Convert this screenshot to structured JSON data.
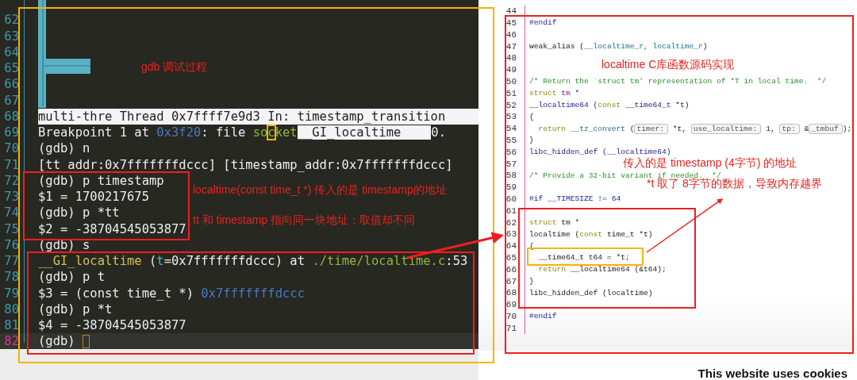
{
  "terminal": {
    "lines": [
      {
        "number": "62",
        "current": false
      },
      {
        "number": "63",
        "current": false
      },
      {
        "number": "64",
        "current": false
      },
      {
        "number": "65",
        "current": false
      },
      {
        "number": "66",
        "current": false
      },
      {
        "number": "67",
        "current": false
      },
      {
        "number": "68",
        "current": false,
        "kind": "status",
        "segments": [
          {
            "text": "multi-thre Thread 0x7ffff7e9d3 In: timestamp_transition",
            "kind": "plain"
          }
        ]
      },
      {
        "number": "69",
        "current": false,
        "segments": [
          {
            "text": "Breakpoint 1 at ",
            "kind": "plain"
          },
          {
            "text": "0x3f20",
            "kind": "address"
          },
          {
            "text": ": file ",
            "kind": "plain"
          },
          {
            "text": "so",
            "kind": "path"
          },
          {
            "text": "c",
            "kind": "marked"
          },
          {
            "text": "ket",
            "kind": "path"
          },
          {
            "text": "__GI_localtime",
            "kind": "popup"
          },
          {
            "text": "0.",
            "kind": "plain"
          }
        ]
      },
      {
        "number": "70",
        "current": false,
        "segments": [
          {
            "text": "(gdb) n",
            "kind": "plain"
          }
        ]
      },
      {
        "number": "71",
        "current": false,
        "segments": [
          {
            "text": "[tt_addr:0x7fffffffdccc] [timestamp_addr:0x7fffffffdccc]",
            "kind": "plain"
          }
        ]
      },
      {
        "number": "72",
        "current": false,
        "segments": [
          {
            "text": "(gdb) p timestamp",
            "kind": "plain"
          }
        ]
      },
      {
        "number": "73",
        "current": false,
        "segments": [
          {
            "text": "$1 = 1700217675",
            "kind": "plain"
          }
        ]
      },
      {
        "number": "74",
        "current": false,
        "segments": [
          {
            "text": "(gdb) p *tt",
            "kind": "plain"
          }
        ]
      },
      {
        "number": "75",
        "current": false,
        "segments": [
          {
            "text": "$2 = -38704545053877",
            "kind": "plain"
          }
        ]
      },
      {
        "number": "76",
        "current": false,
        "segments": [
          {
            "text": "(gdb) s",
            "kind": "plain"
          }
        ]
      },
      {
        "number": "77",
        "current": false,
        "segments": [
          {
            "text": "__GI_localtime",
            "kind": "function"
          },
          {
            "text": " (",
            "kind": "plain"
          },
          {
            "text": "t",
            "kind": "variable"
          },
          {
            "text": "=0x7fffffffdccc) at ",
            "kind": "plain"
          },
          {
            "text": "./time/localtime.c",
            "kind": "path"
          },
          {
            "text": ":53",
            "kind": "plain"
          }
        ]
      },
      {
        "number": "78",
        "current": false,
        "segments": [
          {
            "text": "(gdb) p t",
            "kind": "plain"
          }
        ]
      },
      {
        "number": "79",
        "current": false,
        "segments": [
          {
            "text": "$3 = (const time_t *) ",
            "kind": "plain"
          },
          {
            "text": "0x7fffffffdccc",
            "kind": "address"
          }
        ]
      },
      {
        "number": "80",
        "current": false,
        "segments": [
          {
            "text": "(gdb) p *t",
            "kind": "plain"
          }
        ]
      },
      {
        "number": "81",
        "current": false,
        "segments": [
          {
            "text": "$4 = -38704545053877",
            "kind": "plain"
          }
        ]
      },
      {
        "number": "82",
        "current": true,
        "segments": [
          {
            "text": "(gdb) ",
            "kind": "plain"
          }
        ]
      }
    ]
  },
  "source": {
    "lines": [
      {
        "number": "44"
      },
      {
        "number": "45",
        "segments": [
          {
            "text": "#endif",
            "kind": "preprocessor"
          }
        ]
      },
      {
        "number": "46"
      },
      {
        "number": "47",
        "segments": [
          {
            "text": "weak_alias (",
            "kind": "plain"
          },
          {
            "text": "__localtime_r, localtime_r",
            "kind": "type"
          },
          {
            "text": ")",
            "kind": "plain"
          }
        ]
      },
      {
        "number": "48"
      },
      {
        "number": "49"
      },
      {
        "number": "50",
        "segments": [
          {
            "text": "/* Return the `struct tm' representation of *T in local time.  */",
            "kind": "comment"
          }
        ]
      },
      {
        "number": "51",
        "segments": [
          {
            "text": "struct ",
            "kind": "keyword"
          },
          {
            "text": "tm",
            "kind": "macro"
          },
          {
            "text": " *",
            "kind": "plain"
          }
        ]
      },
      {
        "number": "52",
        "segments": [
          {
            "text": "__localtime64 (",
            "kind": "preprocessor"
          },
          {
            "text": "const",
            "kind": "keyword"
          },
          {
            "text": " __time64_t ",
            "kind": "preprocessor"
          },
          {
            "text": "*t)",
            "kind": "plain"
          }
        ]
      },
      {
        "number": "53",
        "segments": [
          {
            "text": "{",
            "kind": "plain"
          }
        ]
      },
      {
        "number": "54",
        "segments": [
          {
            "text": "  return",
            "kind": "keyword"
          },
          {
            "text": " __tz_convert",
            "kind": "type"
          },
          {
            "text": " (",
            "kind": "plain"
          },
          {
            "text": "timer:",
            "kind": "hint"
          },
          {
            "text": " *t, ",
            "kind": "plain"
          },
          {
            "text": "use_localtime:",
            "kind": "hint"
          },
          {
            "text": " 1",
            "kind": "preprocessor"
          },
          {
            "text": ", ",
            "kind": "plain"
          },
          {
            "text": "tp:",
            "kind": "hint"
          },
          {
            "text": " &",
            "kind": "plain"
          },
          {
            "text": "_tmbuf",
            "kind": "hint"
          },
          {
            "text": ");",
            "kind": "plain"
          }
        ]
      },
      {
        "number": "55",
        "segments": [
          {
            "text": "}",
            "kind": "plain"
          }
        ]
      },
      {
        "number": "56",
        "segments": [
          {
            "text": "libc_hidden_def (",
            "kind": "preprocessor"
          },
          {
            "text": "__localtime64",
            "kind": "preprocessor"
          },
          {
            "text": ")",
            "kind": "plain"
          }
        ]
      },
      {
        "number": "57"
      },
      {
        "number": "58",
        "segments": [
          {
            "text": "/* Provide a 32-bit variant if needed.  */",
            "kind": "comment"
          }
        ]
      },
      {
        "number": "59"
      },
      {
        "number": "60",
        "segments": [
          {
            "text": "#if __TIMESIZE != 64",
            "kind": "preprocessor"
          }
        ]
      },
      {
        "number": "61"
      },
      {
        "number": "62",
        "segments": [
          {
            "text": "struct",
            "kind": "keyword"
          },
          {
            "text": " tm *",
            "kind": "plain"
          }
        ]
      },
      {
        "number": "63",
        "segments": [
          {
            "text": "localtime (",
            "kind": "plain"
          },
          {
            "text": "const",
            "kind": "keyword"
          },
          {
            "text": " time_t *t)",
            "kind": "plain"
          }
        ]
      },
      {
        "number": "64",
        "segments": [
          {
            "text": "{",
            "kind": "plain"
          }
        ]
      },
      {
        "number": "65",
        "segments": [
          {
            "text": "  __time64_t t64 = *t;",
            "kind": "plain"
          }
        ]
      },
      {
        "number": "66",
        "segments": [
          {
            "text": "  return",
            "kind": "keyword"
          },
          {
            "text": " __localtime64 (&t64);",
            "kind": "plain"
          }
        ]
      },
      {
        "number": "67",
        "segments": [
          {
            "text": "}",
            "kind": "plain"
          }
        ]
      },
      {
        "number": "68",
        "segments": [
          {
            "text": "libc_hidden_def (localtime)",
            "kind": "plain"
          }
        ]
      },
      {
        "number": "69"
      },
      {
        "number": "70",
        "segments": [
          {
            "text": "#endif",
            "kind": "preprocessor"
          }
        ]
      },
      {
        "number": "71"
      }
    ]
  },
  "annotations": [
    {
      "text": "gdb 调试过程"
    },
    {
      "text": "localtime C库函数源码实现"
    },
    {
      "text": "localtime(const time_t *) 传入的是 timestamp的地址"
    },
    {
      "text": "tt 和 timestamp 指向同一块地址：取值却不同"
    },
    {
      "text": "传入的是 timestamp (4字节) 的地址"
    },
    {
      "text": "*t 取了 8字节的数据，导致内存越界"
    }
  ],
  "cookie_notice": {
    "title": "This website uses cookies"
  }
}
